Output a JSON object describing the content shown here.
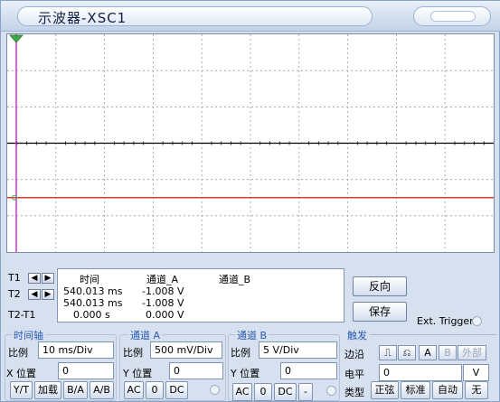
{
  "window": {
    "title": "示波器-XSC1"
  },
  "readout": {
    "headers": {
      "time": "时间",
      "ch_a": "通道_A",
      "ch_b": "通道_B"
    },
    "rows": [
      {
        "label": "T1",
        "time": "540.013 ms",
        "ch_a": "-1.008 V",
        "ch_b": ""
      },
      {
        "label": "T2",
        "time": "540.013 ms",
        "ch_a": "-1.008 V",
        "ch_b": ""
      },
      {
        "label": "T2-T1",
        "time": "0.000 s",
        "ch_a": "0.000 V",
        "ch_b": ""
      }
    ]
  },
  "buttons": {
    "reverse": "反向",
    "save": "保存"
  },
  "ext_trigger": "Ext. Trigger",
  "timebase": {
    "title": "时间轴",
    "scale_label": "比例",
    "scale_value": "10 ms/Div",
    "xpos_label": "X 位置",
    "xpos_value": "0",
    "modes": [
      "Y/T",
      "加载",
      "B/A",
      "A/B"
    ]
  },
  "channel_a": {
    "title": "通道 A",
    "scale_label": "比例",
    "scale_value": "500 mV/Div",
    "ypos_label": "Y 位置",
    "ypos_value": "0",
    "coupling": [
      "AC",
      "0",
      "DC"
    ]
  },
  "channel_b": {
    "title": "通道 B",
    "scale_label": "比例",
    "scale_value": "5  V/Div",
    "ypos_label": "Y 位置",
    "ypos_value": "0",
    "coupling": [
      "AC",
      "0",
      "DC",
      "-"
    ]
  },
  "trigger": {
    "title": "触发",
    "edge_label": "边沿",
    "source_buttons": [
      "A",
      "B",
      "外部"
    ],
    "level_label": "电平",
    "level_value": "0",
    "level_unit": "V",
    "type_label": "类型",
    "types": [
      "正弦",
      "标准",
      "自动",
      "无"
    ]
  },
  "colors": {
    "trace_a": "#000000",
    "trace_b": "#c8442a",
    "cursor_1": "#d030d0",
    "cursor_2": "#3aa848"
  },
  "traces": {
    "time_div": "10 ms/Div",
    "channel_a_level_divs": 0.0,
    "channel_b_level_divs": -1.5
  }
}
